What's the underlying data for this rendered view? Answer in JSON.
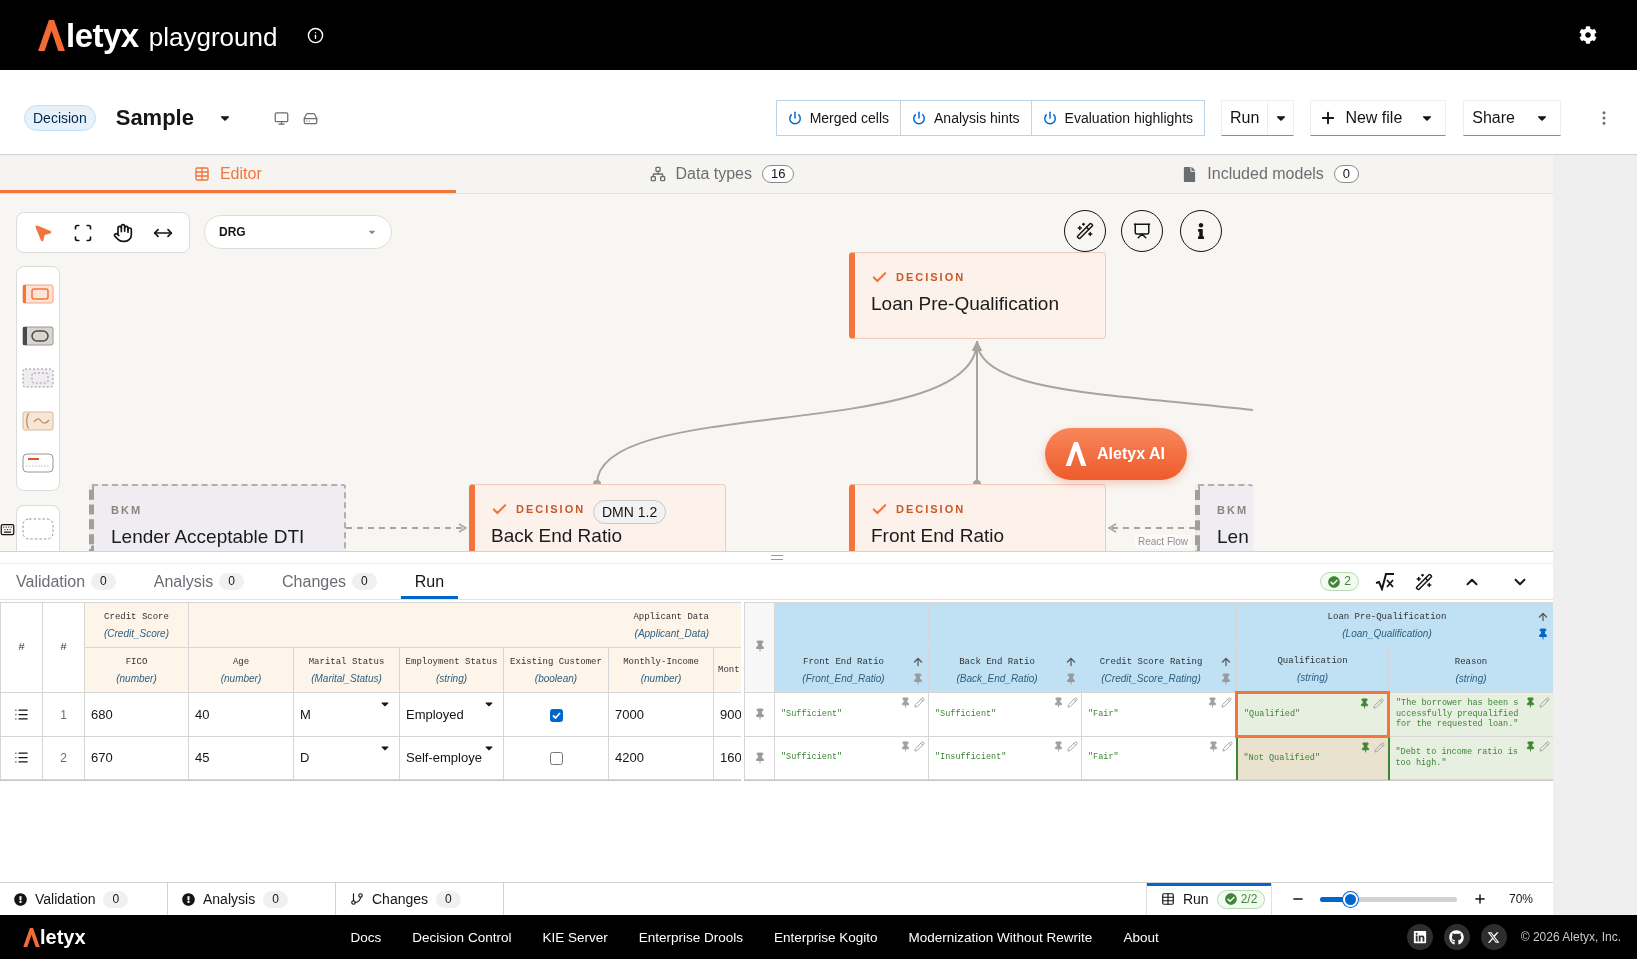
{
  "app_header": {
    "brand_text": "letyx",
    "product": "playground"
  },
  "toolbar": {
    "model_type": "Decision",
    "file_name": "Sample",
    "toggles": [
      "Merged cells",
      "Analysis hints",
      "Evaluation highlights"
    ],
    "run": "Run",
    "new_file": "New file",
    "share": "Share"
  },
  "editor_tabs": [
    {
      "kind": "editor",
      "label": "Editor",
      "selected": true
    },
    {
      "kind": "data_types",
      "label": "Data types",
      "count": "16",
      "selected": false
    },
    {
      "kind": "included_models",
      "label": "Included models",
      "count": "0",
      "selected": false
    }
  ],
  "canvas": {
    "tools": [
      {
        "kind": "pointer",
        "selected": true
      },
      {
        "kind": "frame",
        "selected": false
      },
      {
        "kind": "hand",
        "selected": false
      },
      {
        "kind": "pan",
        "selected": false
      }
    ],
    "view": "DRG",
    "nodes": [
      {
        "kind": "decision",
        "type_label": "DECISION",
        "name": "Loan Pre-Qualification"
      },
      {
        "kind": "bkm",
        "type_label": "BKM",
        "name": "Lender Acceptable DTI"
      },
      {
        "kind": "decision",
        "type_label": "DECISION",
        "name": "Back End Ratio"
      },
      {
        "kind": "decision",
        "type_label": "DECISION",
        "name": "Front End Ratio"
      },
      {
        "kind": "bkm",
        "type_label": "BKM",
        "name": "Len"
      }
    ],
    "dmn_version": "DMN 1.2",
    "ai_button": "Aletyx AI",
    "attribution": "React Flow"
  },
  "panel_tabs": [
    {
      "label": "Validation",
      "count": "0",
      "selected": false
    },
    {
      "label": "Analysis",
      "count": "0",
      "selected": false
    },
    {
      "label": "Changes",
      "count": "0",
      "selected": false
    },
    {
      "label": "Run",
      "selected": true
    }
  ],
  "run_result_badge": "2",
  "input_table": {
    "index_headers": [
      "#",
      "#"
    ],
    "groups": [
      {
        "title": "Credit Score",
        "type": "(Credit_Score)",
        "columns": [
          {
            "kind": "text",
            "title": "FICO",
            "type": "(number)"
          }
        ]
      },
      {
        "title": "Applicant Data",
        "type": "(Applicant_Data)",
        "columns": [
          {
            "kind": "text",
            "title": "Age",
            "type": "(number)"
          },
          {
            "kind": "select",
            "title": "Marital Status",
            "type": "(Marital_Status)"
          },
          {
            "kind": "select",
            "title": "Employment Status",
            "type": "(string)"
          },
          {
            "kind": "checkbox",
            "title": "Existing Customer",
            "type": "(boolean)"
          },
          {
            "kind": "text",
            "title": "Monthly-Income",
            "type": "(number)"
          },
          {
            "kind": "text",
            "title": "Mont"
          }
        ]
      }
    ],
    "rows": [
      {
        "number": "1",
        "cells": [
          "680",
          "40",
          "M",
          "Employed",
          {
            "checked": true
          },
          "7000",
          "900"
        ]
      },
      {
        "number": "2",
        "cells": [
          "670",
          "45",
          "D",
          "Self-employe",
          {
            "checked": false
          },
          "4200",
          "160"
        ]
      }
    ]
  },
  "output_table": {
    "input_columns": [
      {
        "title": "Front End Ratio",
        "type": "(Front_End_Ratio)",
        "pinned": false
      },
      {
        "title": "Back End Ratio",
        "type": "(Back_End_Ratio)",
        "pinned": false
      },
      {
        "title": "Credit Score Rating",
        "type": "(Credit_Score_Rating)",
        "pinned": false
      }
    ],
    "output_group": {
      "title": "Loan Pre-Qualification",
      "type": "(Loan_Qualification)",
      "pinned": true,
      "columns": [
        {
          "title": "Qualification",
          "type": "(string)"
        },
        {
          "title": "Reason",
          "type": "(string)"
        }
      ]
    },
    "rows": [
      {
        "inputs": [
          "\"Sufficient\"",
          "\"Sufficient\"",
          "\"Fair\""
        ],
        "outputs": [
          {
            "value": "\"Qualified\"",
            "selected": true,
            "color": "#e6efe0"
          },
          {
            "value": "\"The borrower has been successfully prequalified for the requested loan.\"",
            "selected": false,
            "color": "#e6efe0"
          }
        ]
      },
      {
        "inputs": [
          "\"Sufficient\"",
          "\"Insufficient\"",
          "\"Fair\""
        ],
        "outputs": [
          {
            "value": "\"Not Qualified\"",
            "selected": false,
            "color": "#e9e2cf"
          },
          {
            "value": "\"Debt to income ratio is too high.\"",
            "selected": false,
            "color": "#e6efe0"
          }
        ]
      }
    ]
  },
  "status_bar": {
    "items": [
      {
        "kind": "validation",
        "label": "Validation",
        "count": "0"
      },
      {
        "kind": "analysis",
        "label": "Analysis",
        "count": "0"
      },
      {
        "kind": "changes",
        "label": "Changes",
        "count": "0"
      }
    ],
    "run": {
      "label": "Run",
      "result": "2/2",
      "selected": true
    },
    "zoom": {
      "level": 0.17,
      "reading": "70%"
    }
  },
  "footer": {
    "brand_text": "letyx",
    "links": [
      "Docs",
      "Decision Control",
      "KIE Server",
      "Enterprise Drools",
      "Enterprise Kogito",
      "Modernization Without Rewrite",
      "About"
    ],
    "copyright": "© 2026 Aletyx, Inc."
  }
}
